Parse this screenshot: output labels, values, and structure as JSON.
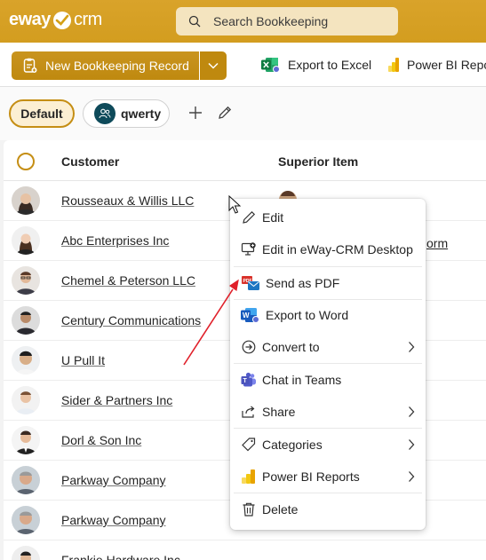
{
  "header": {
    "logo_left": "eway",
    "logo_right": "crm",
    "search_placeholder": "Search Bookkeeping"
  },
  "commandbar": {
    "new_record_label": "New Bookkeeping Record",
    "export_excel_label": "Export to Excel",
    "power_bi_label": "Power BI Repo"
  },
  "views": {
    "default_label": "Default",
    "qwerty_label": "qwerty"
  },
  "grid": {
    "columns": [
      "Customer",
      "Superior Item"
    ],
    "rows": [
      {
        "customer": "Rousseaux & Willis LLC",
        "avatar": "person-woman-dark-hair"
      },
      {
        "customer": "Abc Enterprises Inc",
        "avatar": "person-woman-long-hair"
      },
      {
        "customer": "Chemel & Peterson LLC",
        "avatar": "person-man-glasses"
      },
      {
        "customer": "Century Communications",
        "avatar": "person-man-suit"
      },
      {
        "customer": "U Pull It",
        "avatar": "person-man-smiling"
      },
      {
        "customer": "Sider & Partners Inc",
        "avatar": "person-man-light"
      },
      {
        "customer": "Dorl & Son Inc",
        "avatar": "person-man-beard"
      },
      {
        "customer": "Parkway Company",
        "avatar": "person-older-man"
      },
      {
        "customer": "Parkway Company",
        "avatar": "person-older-man"
      },
      {
        "customer": "Frankie Hardware Inc",
        "avatar": "person-man"
      }
    ],
    "partial_text": "orm"
  },
  "context_menu": {
    "items": [
      {
        "label": "Edit",
        "icon": "pencil-icon"
      },
      {
        "label": "Edit in eWay-CRM Desktop",
        "icon": "desktop-edit-icon"
      },
      {
        "label": "Send as PDF",
        "icon": "pdf-mail-icon"
      },
      {
        "label": "Export to Word",
        "icon": "word-icon"
      },
      {
        "label": "Convert to",
        "icon": "convert-arrow-icon",
        "submenu": true
      },
      {
        "label": "Chat in Teams",
        "icon": "teams-icon"
      },
      {
        "label": "Share",
        "icon": "share-icon",
        "submenu": true
      },
      {
        "label": "Categories",
        "icon": "tag-icon",
        "submenu": true
      },
      {
        "label": "Power BI Reports",
        "icon": "power-bi-icon",
        "submenu": true
      },
      {
        "label": "Delete",
        "icon": "trash-icon"
      }
    ]
  },
  "colors": {
    "brand": "#d4a017",
    "accent_dark": "#c58e14",
    "annotation_arrow": "#e0202a"
  }
}
